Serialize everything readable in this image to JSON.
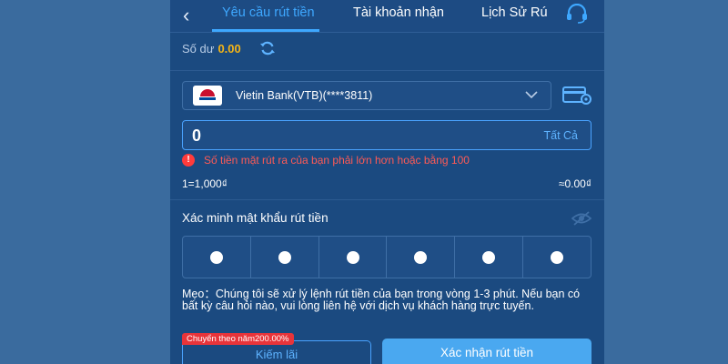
{
  "header": {
    "tabs": [
      {
        "label": "Yêu cầu rút tiền",
        "active": true
      },
      {
        "label": "Tài khoản nhận",
        "active": false
      },
      {
        "label": "Lịch Sử Rú",
        "active": false
      }
    ],
    "back_icon": "chevron-left-icon",
    "support_icon": "headset-icon"
  },
  "balance": {
    "label": "Số dư",
    "value": "0.00",
    "refresh_icon": "refresh-icon"
  },
  "bank": {
    "selected": "Vietin Bank(VTB)(****3811)",
    "manage_icon": "card-settings-icon"
  },
  "amount": {
    "value": "0",
    "all_label": "Tất Cả"
  },
  "error": {
    "text": "Số tiền mặt rút ra của bạn phải lớn hơn hoặc bằng 100"
  },
  "rate": {
    "left": "1=1,000₫",
    "right": "≈0.00₫"
  },
  "password": {
    "label": "Xác minh mật khẩu rút tiền",
    "digits": 6,
    "toggle_icon": "eye-off-icon"
  },
  "tip": {
    "text": "Mẹo：Chúng tôi sẽ xử lý lệnh rút tiền của bạn trong vòng 1-3 phút. Nếu bạn có bất kỳ câu hỏi nào, vui lòng liên hệ với dịch vụ khách hàng trực tuyến."
  },
  "actions": {
    "promo_badge": "Chuyển theo năm200.00%",
    "earn_label": "Kiếm lãi",
    "confirm_label": "Xác nhận rút tiền"
  },
  "colors": {
    "accent": "#3ea8ff",
    "background": "#1b4a80",
    "error": "#ff5a55",
    "balance": "#f4b417"
  }
}
